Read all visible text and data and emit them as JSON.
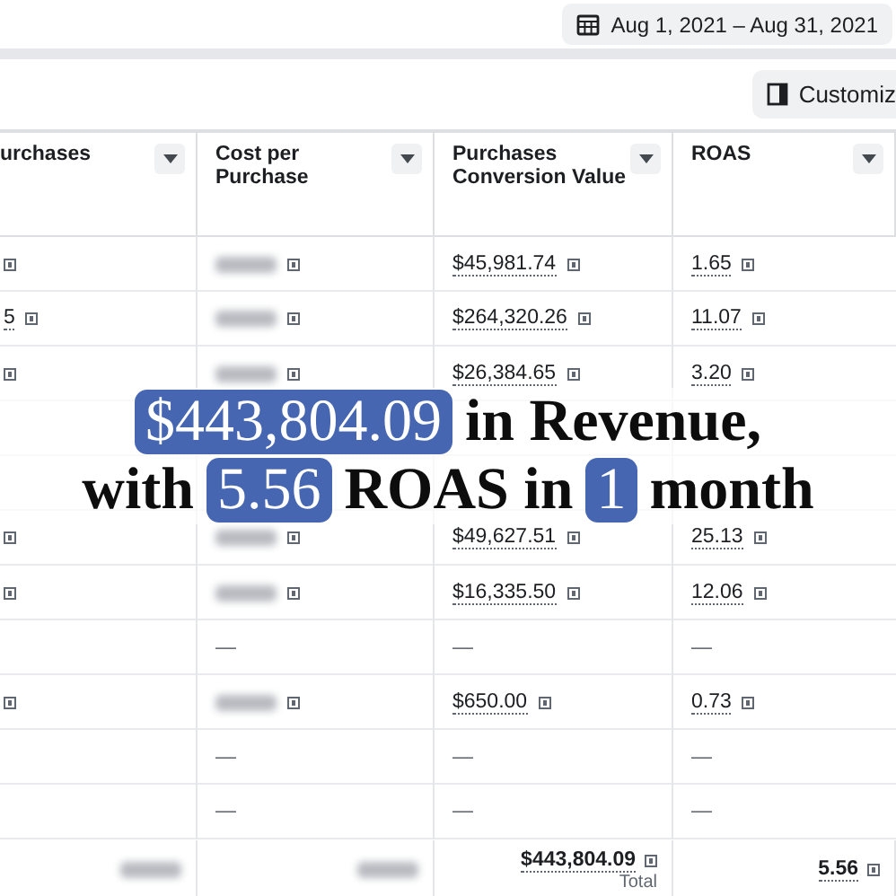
{
  "top_bar": {
    "date_range": "Aug 1, 2021 – Aug 31, 2021"
  },
  "toolbar": {
    "customize_button": "Customiz"
  },
  "table": {
    "columns": [
      "urchases",
      "Cost per Purchase",
      "Purchases Conversion Value",
      "ROAS"
    ],
    "rows": [
      [
        {
          "kind": "info"
        },
        {
          "kind": "blurred"
        },
        {
          "kind": "value",
          "text": "$45,981.74"
        },
        {
          "kind": "value",
          "text": "1.65"
        }
      ],
      [
        {
          "kind": "value",
          "text": "5"
        },
        {
          "kind": "blurred"
        },
        {
          "kind": "value",
          "text": "$264,320.26"
        },
        {
          "kind": "value",
          "text": "11.07"
        }
      ],
      [
        {
          "kind": "info"
        },
        {
          "kind": "blurred"
        },
        {
          "kind": "value",
          "text": "$26,384.65"
        },
        {
          "kind": "value",
          "text": "3.20"
        }
      ],
      [
        {
          "kind": "empty"
        },
        {
          "kind": "empty"
        },
        {
          "kind": "empty"
        },
        {
          "kind": "empty"
        }
      ],
      [
        {
          "kind": "empty"
        },
        {
          "kind": "empty"
        },
        {
          "kind": "empty"
        },
        {
          "kind": "empty"
        }
      ],
      [
        {
          "kind": "info"
        },
        {
          "kind": "blurred"
        },
        {
          "kind": "value",
          "text": "$49,627.51"
        },
        {
          "kind": "value",
          "text": "25.13"
        }
      ],
      [
        {
          "kind": "info"
        },
        {
          "kind": "blurred"
        },
        {
          "kind": "value",
          "text": "$16,335.50"
        },
        {
          "kind": "value",
          "text": "12.06"
        }
      ],
      [
        {
          "kind": "empty"
        },
        {
          "kind": "dash",
          "text": "—"
        },
        {
          "kind": "dash",
          "text": "—"
        },
        {
          "kind": "dash",
          "text": "—"
        }
      ],
      [
        {
          "kind": "info"
        },
        {
          "kind": "blurred"
        },
        {
          "kind": "value",
          "text": "$650.00"
        },
        {
          "kind": "value",
          "text": "0.73"
        }
      ],
      [
        {
          "kind": "empty"
        },
        {
          "kind": "dash",
          "text": "—"
        },
        {
          "kind": "dash",
          "text": "—"
        },
        {
          "kind": "dash",
          "text": "—"
        }
      ],
      [
        {
          "kind": "empty"
        },
        {
          "kind": "dash",
          "text": "—"
        },
        {
          "kind": "dash",
          "text": "—"
        },
        {
          "kind": "dash",
          "text": "—"
        }
      ]
    ],
    "totals": [
      {
        "kind": "blurred"
      },
      {
        "kind": "blurred"
      },
      {
        "kind": "total",
        "text": "$443,804.09",
        "caption": "Total"
      },
      {
        "kind": "total",
        "text": "5.56"
      }
    ]
  },
  "headline": {
    "lines": [
      [
        {
          "text": "$443,804.09",
          "highlighted": true
        },
        {
          "text": "in Revenue,",
          "highlighted": false
        }
      ],
      [
        {
          "text": "with",
          "highlighted": false
        },
        {
          "text": "5.56",
          "highlighted": true
        },
        {
          "text": "ROAS in",
          "highlighted": false
        },
        {
          "text": "1",
          "highlighted": true
        },
        {
          "text": "month",
          "highlighted": false
        }
      ]
    ]
  }
}
